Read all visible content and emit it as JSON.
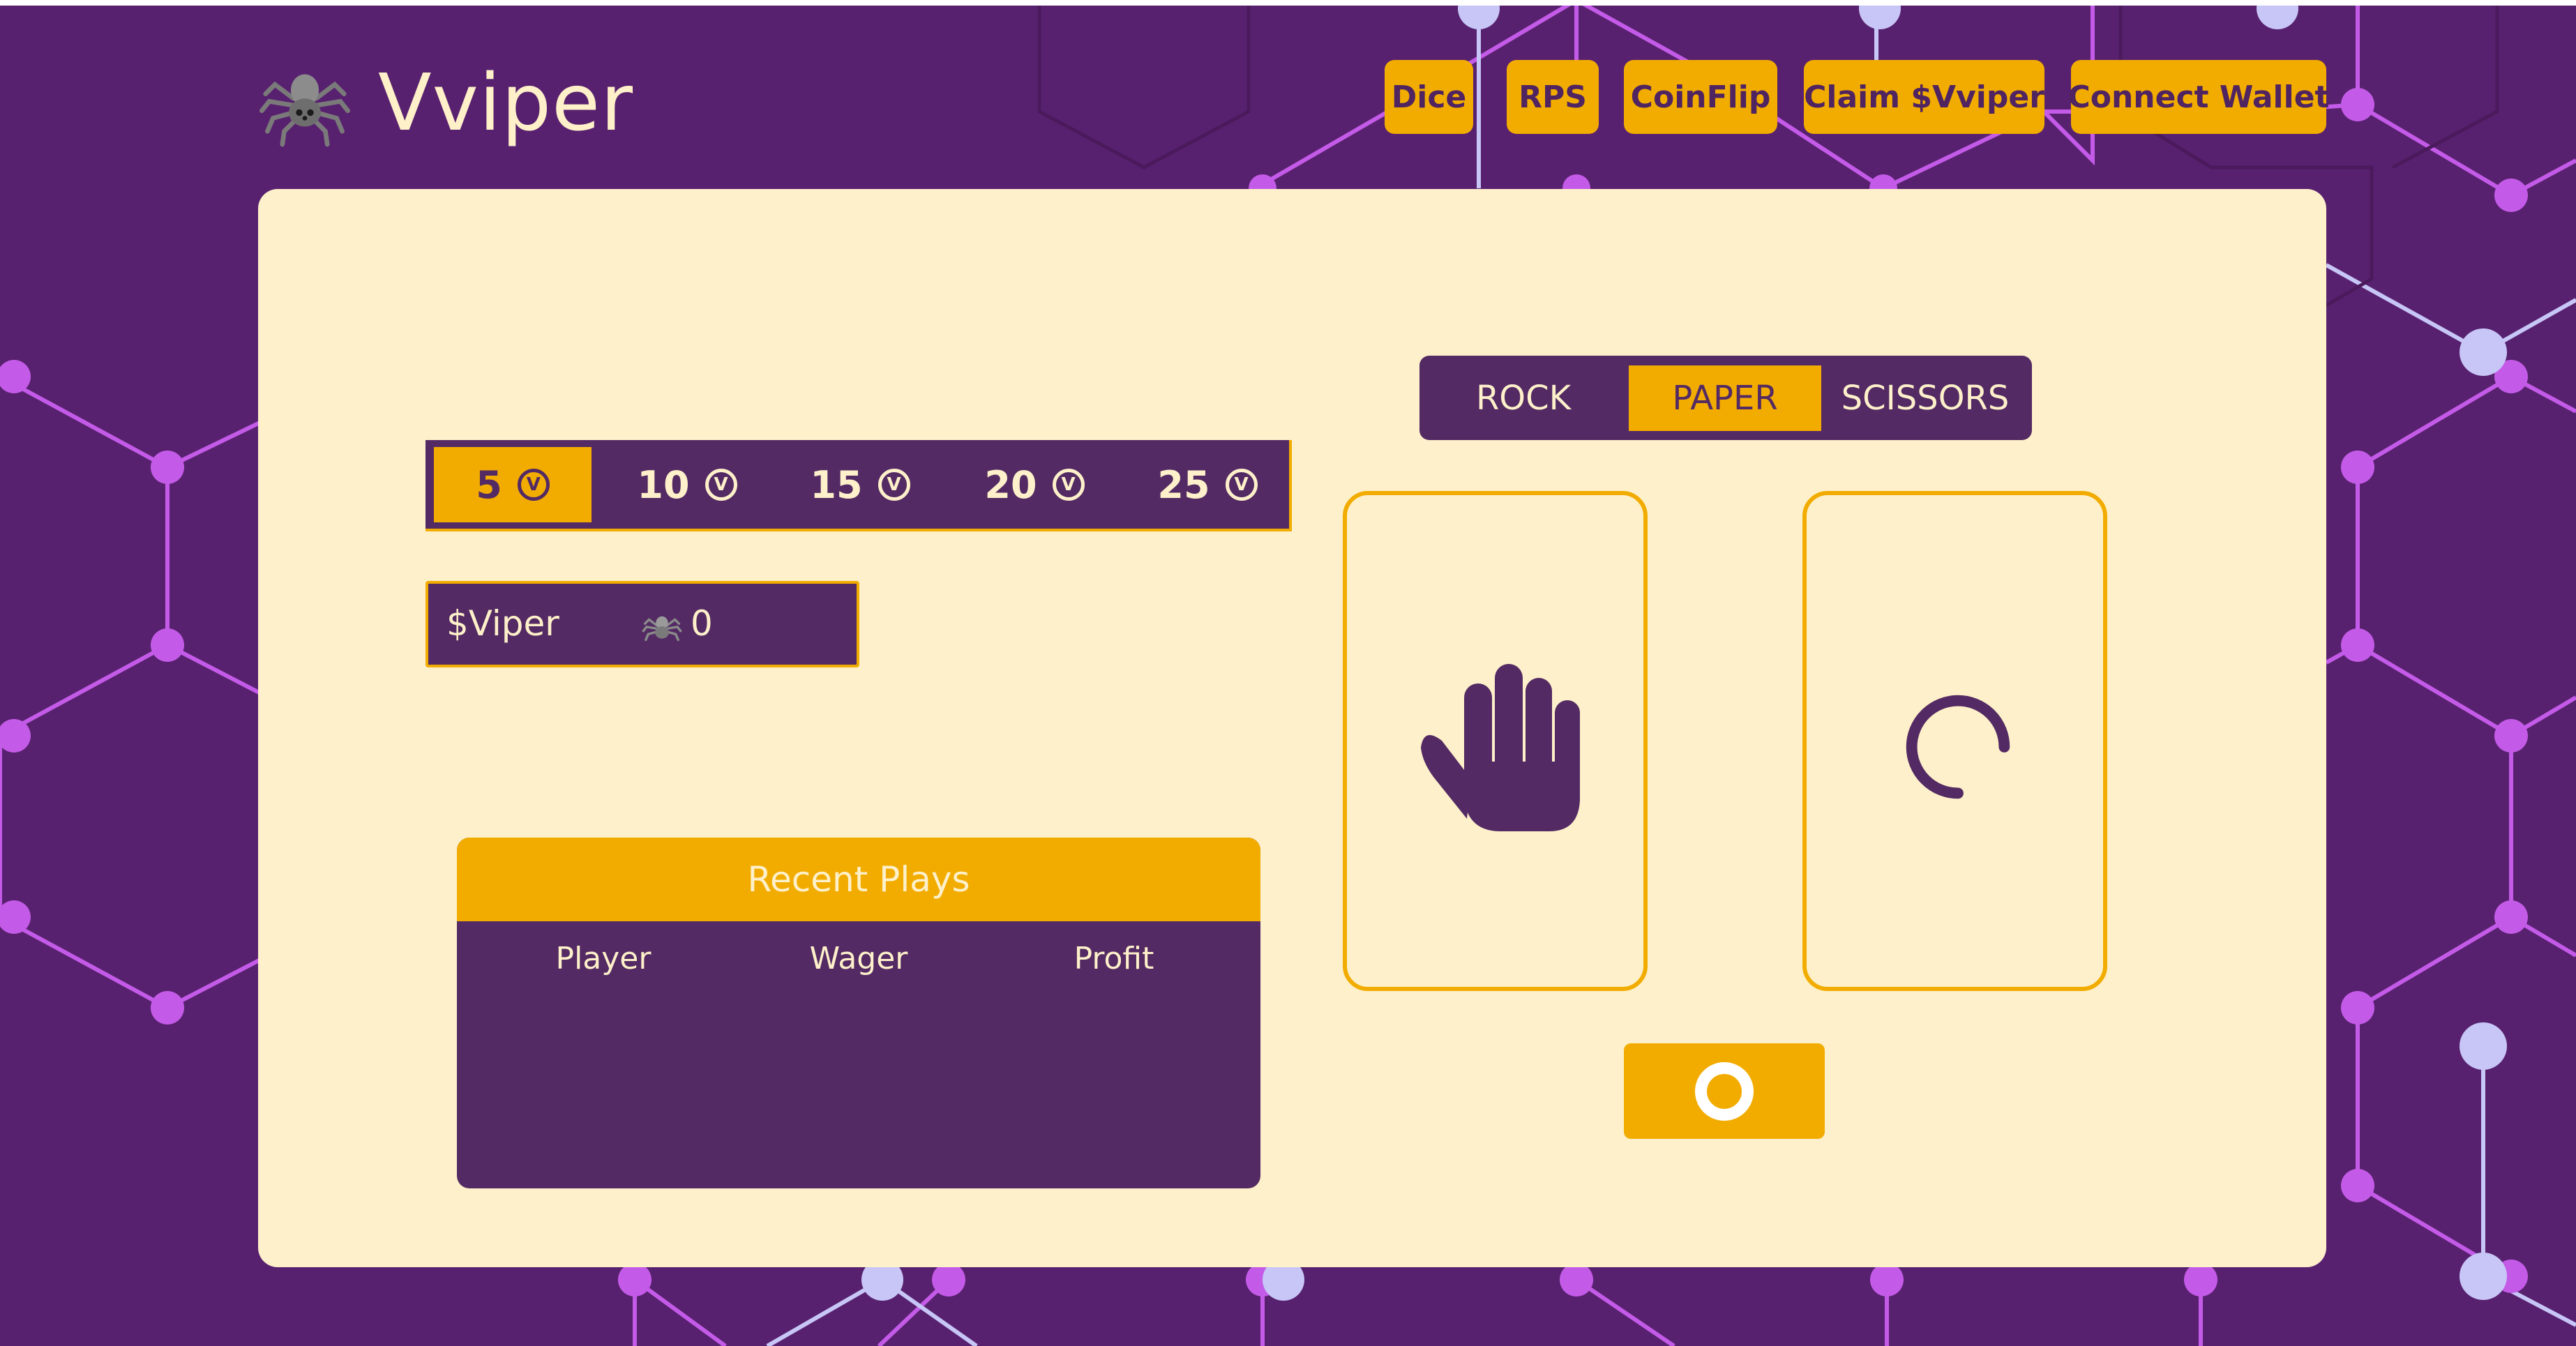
{
  "app": {
    "name": "Vviper",
    "logo_icon": "spider-icon"
  },
  "nav": [
    {
      "label": "Dice"
    },
    {
      "label": "RPS"
    },
    {
      "label": "CoinFlip"
    },
    {
      "label": "Claim $Vviper"
    },
    {
      "label": "Connect Wallet"
    }
  ],
  "wager": {
    "options": [
      {
        "value": "5",
        "selected": true
      },
      {
        "value": "10",
        "selected": false
      },
      {
        "value": "15",
        "selected": false
      },
      {
        "value": "20",
        "selected": false
      },
      {
        "value": "25",
        "selected": false
      }
    ],
    "coin_symbol": "V"
  },
  "balance": {
    "label": "$Viper",
    "value": "0",
    "icon": "spider-icon"
  },
  "recent_plays": {
    "title": "Recent Plays",
    "columns": [
      "Player",
      "Wager",
      "Profit"
    ],
    "rows": []
  },
  "choices": [
    {
      "label": "ROCK",
      "selected": false
    },
    {
      "label": "PAPER",
      "selected": true
    },
    {
      "label": "SCISSORS",
      "selected": false
    }
  ],
  "player_hand": {
    "icon": "paper-hand-icon"
  },
  "opponent_hand": {
    "icon": "loading-spinner-icon"
  },
  "play_button": {
    "icon": "ring-icon"
  },
  "colors": {
    "background": "#58216f",
    "card": "#fdf0ca",
    "accent": "#f2ac00",
    "panel": "#532a63",
    "text_light": "#fdf0ca"
  }
}
